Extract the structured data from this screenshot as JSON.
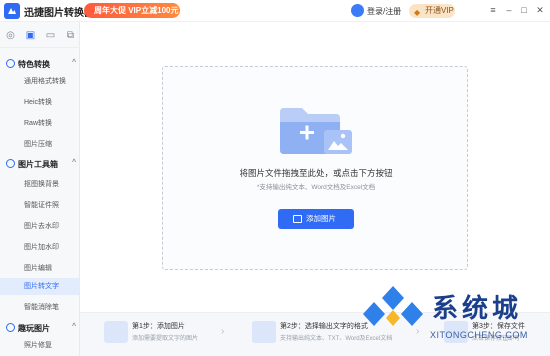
{
  "app": {
    "title": "迅捷图片转换器"
  },
  "header": {
    "promo": "周年大促 VIP立减100元",
    "login": "登录/注册",
    "vip": "开通VIP",
    "window_controls": [
      "menu-icon",
      "minimize-icon",
      "maximize-icon",
      "close-icon"
    ]
  },
  "sidebar": {
    "top_icons": [
      "document-icon",
      "image-icon",
      "folder-icon",
      "copy-icon"
    ],
    "groups": [
      {
        "title": "特色转换",
        "items": [
          "通用格式转换",
          "Heic转换",
          "Raw转换",
          "图片压缩"
        ]
      },
      {
        "title": "图片工具箱",
        "items": [
          "抠图换背景",
          "智能证件照",
          "图片去水印",
          "图片加水印",
          "图片编辑",
          "图片转文字",
          "智能消除笔"
        ]
      },
      {
        "title": "趣玩图片",
        "items": [
          "照片修复"
        ]
      }
    ],
    "selected": "图片转文字"
  },
  "dropzone": {
    "title": "将图片文件拖拽至此处，或点击下方按钮",
    "subtitle": "*支持输出纯文本、Word文档及Excel文档",
    "button": "添加图片"
  },
  "steps": [
    {
      "title": "第1步：添加图片",
      "desc": "添加需要提取文字的图片"
    },
    {
      "title": "第2步：选择输出文字的格式",
      "desc": "支持输出纯文本、TXT、Word及Excel文档"
    },
    {
      "title": "第3步：保存文件",
      "desc": "点击保存按钮即可"
    }
  ],
  "watermark": {
    "text": "系统城",
    "url": "XITONGCHENG.COM"
  },
  "colors": {
    "accent": "#2f6bf5",
    "promo": "#ff5a3c",
    "vip": "#fbe4c6"
  }
}
